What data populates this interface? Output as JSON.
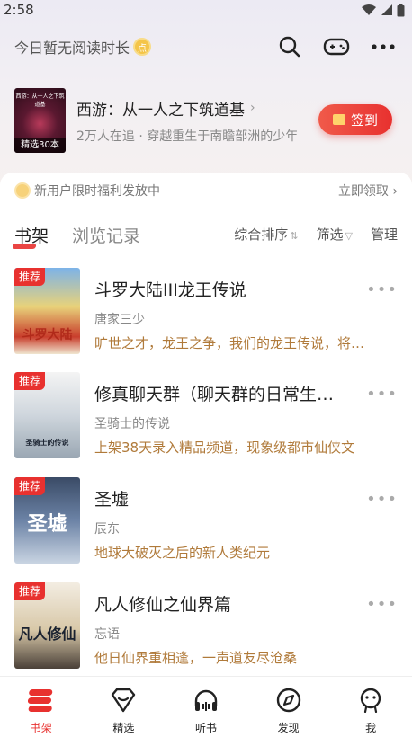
{
  "status": {
    "time": "2:58"
  },
  "header": {
    "reading_time": "今日暂无阅读时长",
    "coin_glyph": "点"
  },
  "recommend": {
    "cover_title": "西游：从一人之下筑道基",
    "cover_badge": "精选30本",
    "title": "西游：从一人之下筑道基",
    "subtitle": "2万人在追 · 穿越重生于南瞻部洲的少年",
    "signin_label": "签到"
  },
  "promo": {
    "text": "新用户限时福利发放中",
    "action": "立即领取"
  },
  "tabs": {
    "bookshelf": "书架",
    "history": "浏览记录"
  },
  "tools": {
    "sort": "综合排序",
    "filter": "筛选",
    "manage": "管理"
  },
  "books": [
    {
      "badge": "推荐",
      "cover_text": "斗罗大陆",
      "title": "斗罗大陆III龙王传说",
      "author": "唐家三少",
      "desc": "旷世之才，龙王之争，我们的龙王传说，将在…"
    },
    {
      "badge": "推荐",
      "cover_text": "圣骑士的传说",
      "title": "修真聊天群（聊天群的日常生…",
      "author": "圣骑士的传说",
      "desc": "上架38天录入精品频道，现象级都市仙侠文"
    },
    {
      "badge": "推荐",
      "cover_text": "圣墟",
      "title": "圣墟",
      "author": "辰东",
      "desc": "地球大破灭之后的新人类纪元"
    },
    {
      "badge": "推荐",
      "cover_text": "凡人修仙",
      "title": "凡人修仙之仙界篇",
      "author": "忘语",
      "desc": "他日仙界重相逢，一声道友尽沧桑"
    }
  ],
  "nav": [
    {
      "label": "书架",
      "icon": "bookshelf-icon"
    },
    {
      "label": "精选",
      "icon": "diamond-icon"
    },
    {
      "label": "听书",
      "icon": "headphones-icon"
    },
    {
      "label": "发现",
      "icon": "compass-icon"
    },
    {
      "label": "我",
      "icon": "profile-icon"
    }
  ],
  "colors": {
    "accent": "#e8312f",
    "desc": "#b07a3a"
  }
}
